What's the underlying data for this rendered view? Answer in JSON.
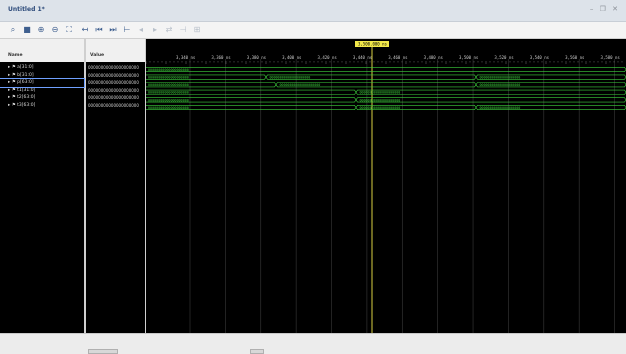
{
  "window": {
    "title": "Untitled 1*",
    "controls": "– ❐ ✕"
  },
  "toolbar": {
    "icons": [
      "search-icon",
      "save-icon",
      "zoom-in-icon",
      "zoom-out-icon",
      "zoom-fit-icon",
      "go-to-cursor-icon",
      "go-to-start-icon",
      "go-to-end-icon",
      "add-marker-icon",
      "previous-marker-icon",
      "next-marker-icon",
      "swap-cursors-icon",
      "snap-icon",
      "expand-icon"
    ],
    "glyphs": [
      "⌕",
      "■",
      "⊕",
      "⊖",
      "⛶",
      "↤",
      "⏮",
      "⏭",
      "⊢",
      "◂",
      "▸",
      "⇄",
      "⊣",
      "⊞"
    ]
  },
  "headers": {
    "name": "Name",
    "value": "Value"
  },
  "cursor": {
    "time_label": "3,500.000 ns"
  },
  "ruler": {
    "ticks": [
      "3,340 ns",
      "3,360 ns",
      "3,380 ns",
      "3,400 ns",
      "3,420 ns",
      "3,440 ns",
      "3,460 ns",
      "3,480 ns",
      "3,500 ns",
      "3,520 ns",
      "3,540 ns",
      "3,560 ns",
      "3,580 ns",
      "3,600 ns"
    ]
  },
  "signals": [
    {
      "name": "▸ ⚑ a[31:0]",
      "value": "00000000000000000000"
    },
    {
      "name": "▸ ⚑ b[31:0]",
      "value": "00000000000000000000"
    },
    {
      "name": "▸ ⚑ p[63:0]",
      "value": "00000000000000000000"
    },
    {
      "name": "▸ ⚑ t1[31:0]",
      "value": "00000000000000000000"
    },
    {
      "name": "▸ ⚑ t2[63:0]",
      "value": "00000000000000000000"
    },
    {
      "name": "▸ ⚑ t3[63:0]",
      "value": "00000000000000000000"
    }
  ],
  "colors": {
    "wave": "#3dd13d",
    "cursor": "#f2e84a",
    "grid": "#3a3a3a",
    "background": "#000000"
  }
}
